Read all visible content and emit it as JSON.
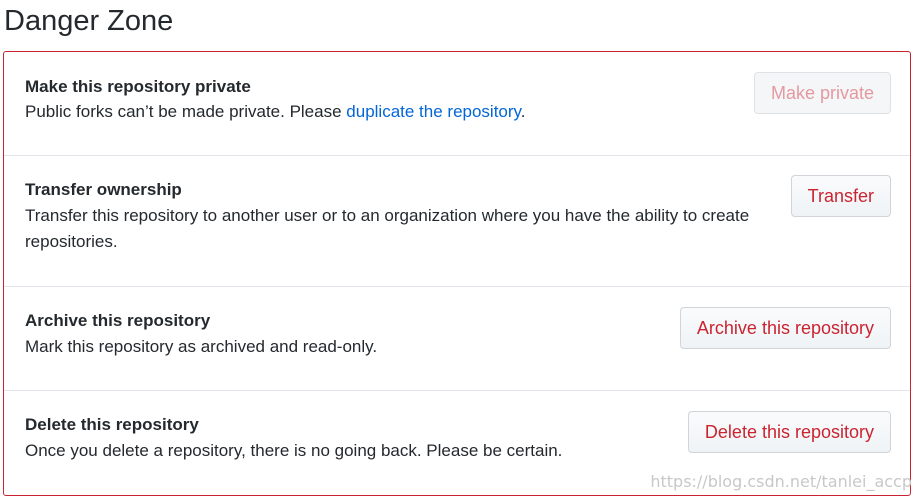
{
  "heading": "Danger Zone",
  "rows": [
    {
      "title": "Make this repository private",
      "description_prefix": "Public forks can’t be made private. Please ",
      "description_link": "duplicate the repository",
      "description_suffix": ".",
      "button": "Make private",
      "button_disabled": true
    },
    {
      "title": "Transfer ownership",
      "description": "Transfer this repository to another user or to an organization where you have the ability to create repositories.",
      "button": "Transfer"
    },
    {
      "title": "Archive this repository",
      "description": "Mark this repository as archived and read-only.",
      "button": "Archive this repository"
    },
    {
      "title": "Delete this repository",
      "description": "Once you delete a repository, there is no going back. Please be certain.",
      "button": "Delete this repository"
    }
  ],
  "watermark": "https://blog.csdn.net/tanlei_accp",
  "colors": {
    "danger": "#cb2431",
    "link": "#0366d6",
    "text": "#24292e",
    "divider": "#e1e4e8"
  }
}
